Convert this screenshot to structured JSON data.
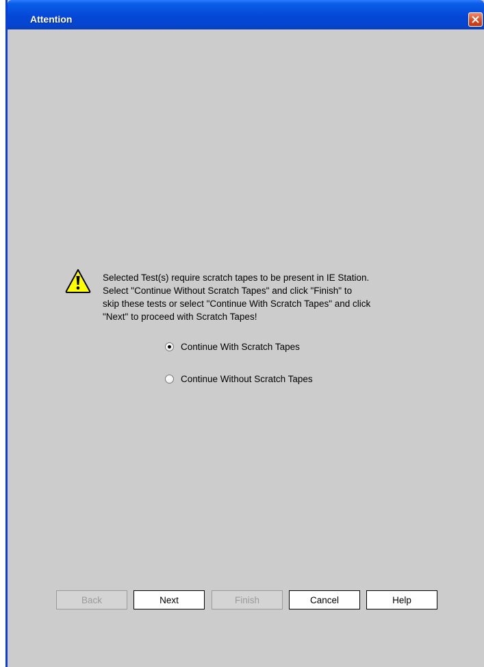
{
  "window": {
    "title": "Attention"
  },
  "message": {
    "lines": [
      "Selected Test(s) require scratch tapes to be present in IE Station.",
      "Select \"Continue Without Scratch Tapes\" and click \"Finish\" to",
      "skip these tests or select \"Continue With Scratch Tapes\" and click",
      "\"Next\" to proceed with Scratch Tapes!"
    ]
  },
  "options": [
    {
      "label": "Continue With Scratch Tapes",
      "selected": true
    },
    {
      "label": "Continue Without Scratch Tapes",
      "selected": false
    }
  ],
  "buttons": {
    "back": {
      "label": "Back",
      "enabled": false
    },
    "next": {
      "label": "Next",
      "enabled": true
    },
    "finish": {
      "label": "Finish",
      "enabled": false
    },
    "cancel": {
      "label": "Cancel",
      "enabled": true
    },
    "help": {
      "label": "Help",
      "enabled": true
    }
  },
  "icons": {
    "warning": "warning-icon",
    "close": "close-icon"
  },
  "colors": {
    "titlebar": "#0547d6",
    "dialog_bg": "#cccccc",
    "close_button": "#d9471d",
    "warning_fill": "#ffff00"
  }
}
